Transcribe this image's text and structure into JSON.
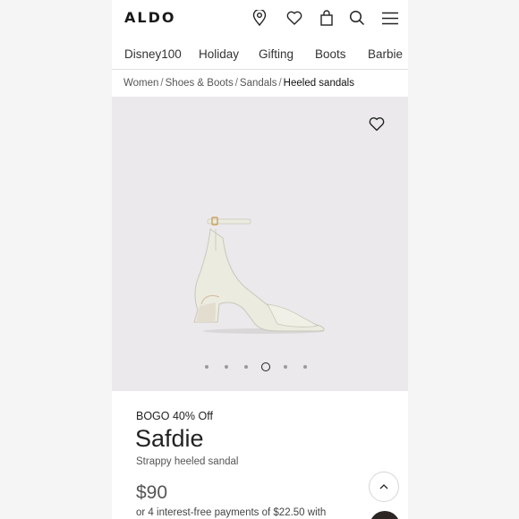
{
  "header": {
    "logo": "ALDO",
    "icons": [
      "location-pin-icon",
      "heart-icon",
      "shopping-bag-icon",
      "search-icon",
      "menu-icon"
    ]
  },
  "nav": {
    "items": [
      "Disney100",
      "Holiday",
      "Gifting",
      "Boots",
      "Barbie"
    ]
  },
  "breadcrumb": {
    "items": [
      "Women",
      "Shoes & Boots",
      "Sandals"
    ],
    "current": "Heeled sandals",
    "separator": "/"
  },
  "gallery": {
    "image": "white-heeled-sandal",
    "slide_count": 6,
    "active_slide": 4
  },
  "product": {
    "promo": "BOGO 40% Off",
    "name": "Safdie",
    "description": "Strappy heeled sandal",
    "price": "$90",
    "installments": "or 4 interest-free payments of $22.50 with"
  },
  "colors": {
    "background": "#ebe9eb",
    "text": "#222222",
    "muted": "#555555"
  }
}
